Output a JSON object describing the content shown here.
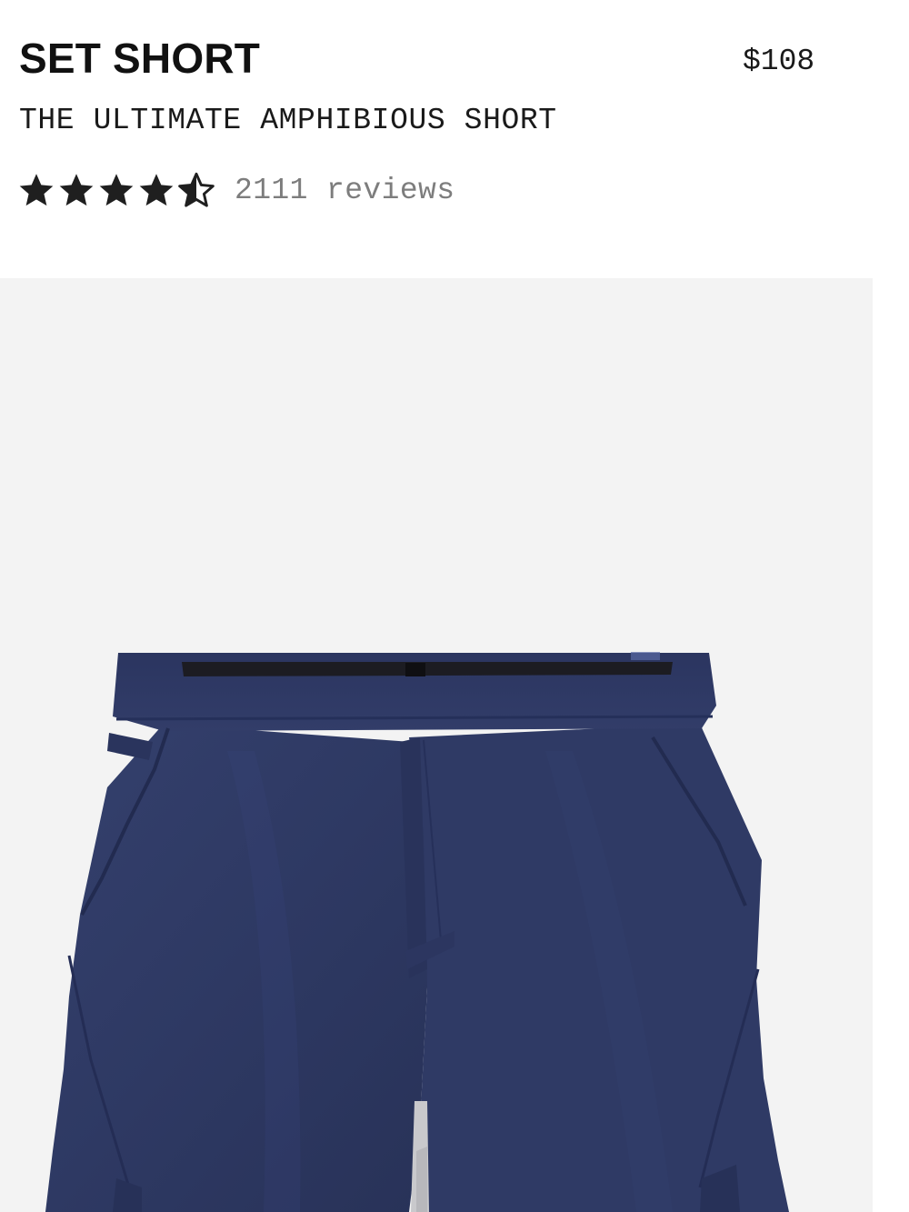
{
  "product": {
    "name": "SET SHORT",
    "price": "$108",
    "tagline": "THE ULTIMATE AMPHIBIOUS SHORT",
    "rating": {
      "stars_filled": 4.5,
      "stars_max": 5,
      "reviews_label": "2111 reviews"
    }
  },
  "gallery": {
    "background": "#f3f3f3",
    "product_color": "#2f3a64"
  },
  "colors": {
    "text": "#111111",
    "muted_text": "#7d7d7d",
    "star": "#1f1f1f"
  }
}
